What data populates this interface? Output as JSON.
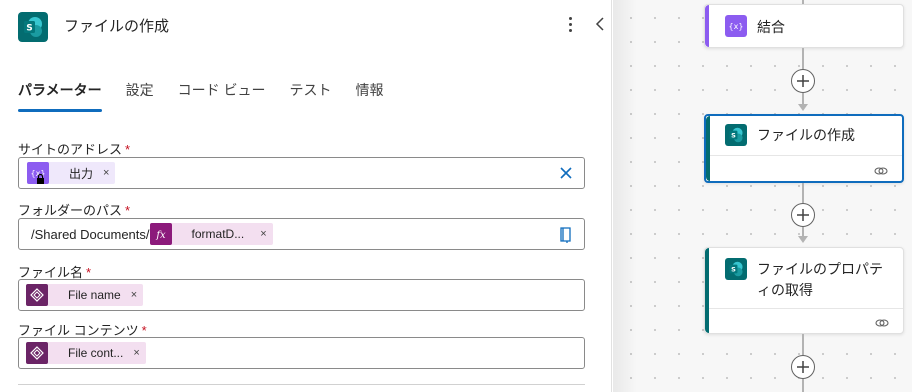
{
  "panel": {
    "title": "ファイルの作成",
    "tabs": [
      "パラメーター",
      "設定",
      "コード ビュー",
      "テスト",
      "情報"
    ],
    "active_tab": "パラメーター",
    "fields": {
      "site": {
        "label": "サイトのアドレス",
        "required_mark": "*",
        "token_label": "出力",
        "token_close": "×"
      },
      "folder": {
        "label": "フォルダーのパス",
        "required_mark": "*",
        "prefix_text": "/Shared Documents/",
        "token_label": "formatD...",
        "token_close": "×"
      },
      "filename": {
        "label": "ファイル名",
        "required_mark": "*",
        "token_label": "File name",
        "token_close": "×"
      },
      "content": {
        "label": "ファイル コンテンツ",
        "required_mark": "*",
        "token_label": "File cont...",
        "token_close": "×"
      }
    }
  },
  "canvas": {
    "cards": [
      {
        "title": "結合",
        "icon": "compose-variable-icon",
        "accent": "#8c5cf0"
      },
      {
        "title": "ファイルの作成",
        "icon": "sharepoint-icon",
        "accent": "#036c70",
        "selected": true
      },
      {
        "title_line1": "ファイルのプロパテ",
        "title_line2": "ィの取得",
        "icon": "sharepoint-icon",
        "accent": "#036c70"
      }
    ]
  },
  "colors": {
    "sharepoint": "#036c70",
    "variable": "#8c5cf0",
    "expression": "#8c1a7b",
    "trigger": "#6b2466",
    "tab_underline": "#0f6cbd",
    "selection": "#0f6cbd",
    "required": "#c50f1f"
  }
}
